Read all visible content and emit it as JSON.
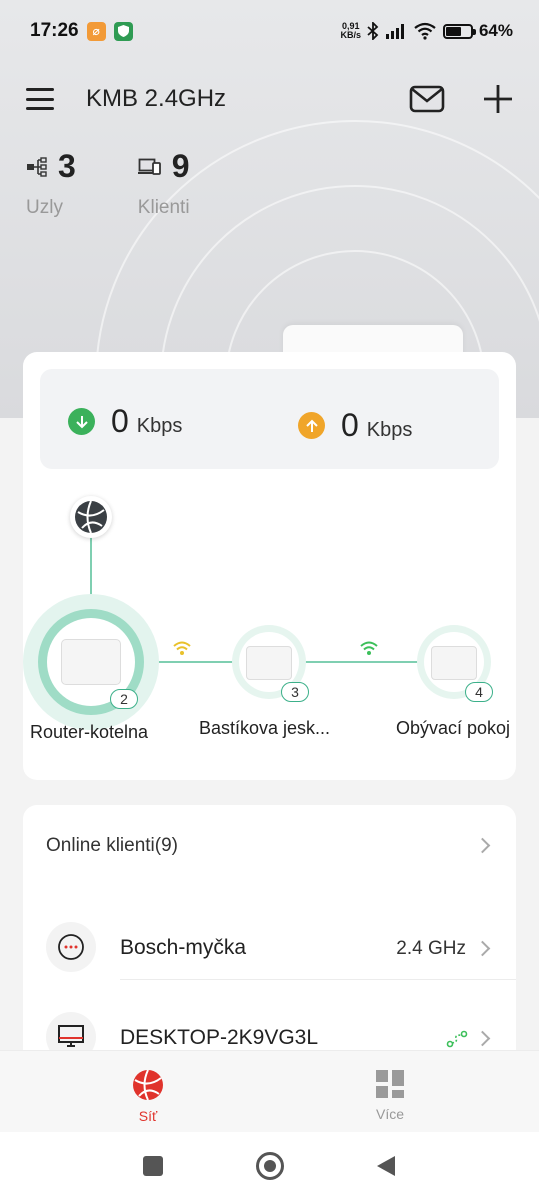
{
  "status_bar": {
    "time": "17:26",
    "net_speed_value": "0,91",
    "net_speed_unit": "KB/s",
    "battery_percent": 64,
    "battery_label": "64%"
  },
  "header": {
    "title": "KMB 2.4GHz"
  },
  "stats": {
    "nodes_count": "3",
    "nodes_label": "Uzly",
    "clients_count": "9",
    "clients_label": "Klienti"
  },
  "speed": {
    "download_value": "0",
    "download_unit": "Kbps",
    "upload_value": "0",
    "upload_unit": "Kbps"
  },
  "topology": {
    "nodes": [
      {
        "label": "Router-kotelna",
        "badge": "2"
      },
      {
        "label": "Bastíkova jesk...",
        "badge": "3"
      },
      {
        "label": "Obývací pokoj",
        "badge": "4"
      }
    ]
  },
  "clients": {
    "header": "Online klienti(9)",
    "items": [
      {
        "name": "Bosch-myčka",
        "band": "2.4 GHz",
        "icon": "more-dots-icon"
      },
      {
        "name": "DESKTOP-2K9VG3L",
        "band": "",
        "icon": "desktop-icon"
      }
    ]
  },
  "bottom_nav": {
    "items": [
      {
        "label": "Síť",
        "icon": "globe-icon",
        "active": true
      },
      {
        "label": "Více",
        "icon": "grid-icon",
        "active": false
      }
    ]
  },
  "colors": {
    "accent_red": "#e0332c",
    "teal": "#3cb08a",
    "download_green": "#3bb15b",
    "upload_orange": "#f0a52a",
    "wifi_yellow": "#e9c12b",
    "wifi_green": "#3cbf5a"
  }
}
